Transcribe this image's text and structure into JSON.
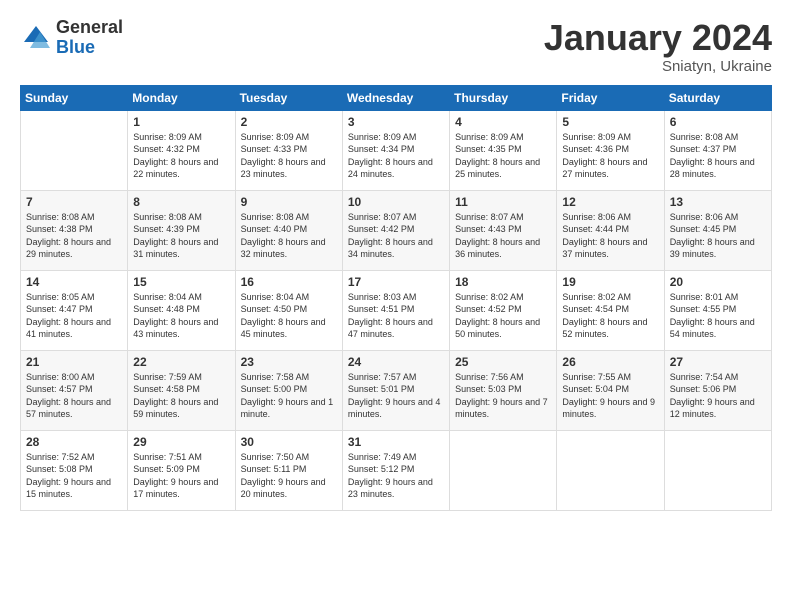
{
  "logo": {
    "general": "General",
    "blue": "Blue"
  },
  "header": {
    "month": "January 2024",
    "location": "Sniatyn, Ukraine"
  },
  "days_of_week": [
    "Sunday",
    "Monday",
    "Tuesday",
    "Wednesday",
    "Thursday",
    "Friday",
    "Saturday"
  ],
  "weeks": [
    [
      {
        "day": "",
        "sunrise": "",
        "sunset": "",
        "daylight": ""
      },
      {
        "day": "1",
        "sunrise": "Sunrise: 8:09 AM",
        "sunset": "Sunset: 4:32 PM",
        "daylight": "Daylight: 8 hours and 22 minutes."
      },
      {
        "day": "2",
        "sunrise": "Sunrise: 8:09 AM",
        "sunset": "Sunset: 4:33 PM",
        "daylight": "Daylight: 8 hours and 23 minutes."
      },
      {
        "day": "3",
        "sunrise": "Sunrise: 8:09 AM",
        "sunset": "Sunset: 4:34 PM",
        "daylight": "Daylight: 8 hours and 24 minutes."
      },
      {
        "day": "4",
        "sunrise": "Sunrise: 8:09 AM",
        "sunset": "Sunset: 4:35 PM",
        "daylight": "Daylight: 8 hours and 25 minutes."
      },
      {
        "day": "5",
        "sunrise": "Sunrise: 8:09 AM",
        "sunset": "Sunset: 4:36 PM",
        "daylight": "Daylight: 8 hours and 27 minutes."
      },
      {
        "day": "6",
        "sunrise": "Sunrise: 8:08 AM",
        "sunset": "Sunset: 4:37 PM",
        "daylight": "Daylight: 8 hours and 28 minutes."
      }
    ],
    [
      {
        "day": "7",
        "sunrise": "Sunrise: 8:08 AM",
        "sunset": "Sunset: 4:38 PM",
        "daylight": "Daylight: 8 hours and 29 minutes."
      },
      {
        "day": "8",
        "sunrise": "Sunrise: 8:08 AM",
        "sunset": "Sunset: 4:39 PM",
        "daylight": "Daylight: 8 hours and 31 minutes."
      },
      {
        "day": "9",
        "sunrise": "Sunrise: 8:08 AM",
        "sunset": "Sunset: 4:40 PM",
        "daylight": "Daylight: 8 hours and 32 minutes."
      },
      {
        "day": "10",
        "sunrise": "Sunrise: 8:07 AM",
        "sunset": "Sunset: 4:42 PM",
        "daylight": "Daylight: 8 hours and 34 minutes."
      },
      {
        "day": "11",
        "sunrise": "Sunrise: 8:07 AM",
        "sunset": "Sunset: 4:43 PM",
        "daylight": "Daylight: 8 hours and 36 minutes."
      },
      {
        "day": "12",
        "sunrise": "Sunrise: 8:06 AM",
        "sunset": "Sunset: 4:44 PM",
        "daylight": "Daylight: 8 hours and 37 minutes."
      },
      {
        "day": "13",
        "sunrise": "Sunrise: 8:06 AM",
        "sunset": "Sunset: 4:45 PM",
        "daylight": "Daylight: 8 hours and 39 minutes."
      }
    ],
    [
      {
        "day": "14",
        "sunrise": "Sunrise: 8:05 AM",
        "sunset": "Sunset: 4:47 PM",
        "daylight": "Daylight: 8 hours and 41 minutes."
      },
      {
        "day": "15",
        "sunrise": "Sunrise: 8:04 AM",
        "sunset": "Sunset: 4:48 PM",
        "daylight": "Daylight: 8 hours and 43 minutes."
      },
      {
        "day": "16",
        "sunrise": "Sunrise: 8:04 AM",
        "sunset": "Sunset: 4:50 PM",
        "daylight": "Daylight: 8 hours and 45 minutes."
      },
      {
        "day": "17",
        "sunrise": "Sunrise: 8:03 AM",
        "sunset": "Sunset: 4:51 PM",
        "daylight": "Daylight: 8 hours and 47 minutes."
      },
      {
        "day": "18",
        "sunrise": "Sunrise: 8:02 AM",
        "sunset": "Sunset: 4:52 PM",
        "daylight": "Daylight: 8 hours and 50 minutes."
      },
      {
        "day": "19",
        "sunrise": "Sunrise: 8:02 AM",
        "sunset": "Sunset: 4:54 PM",
        "daylight": "Daylight: 8 hours and 52 minutes."
      },
      {
        "day": "20",
        "sunrise": "Sunrise: 8:01 AM",
        "sunset": "Sunset: 4:55 PM",
        "daylight": "Daylight: 8 hours and 54 minutes."
      }
    ],
    [
      {
        "day": "21",
        "sunrise": "Sunrise: 8:00 AM",
        "sunset": "Sunset: 4:57 PM",
        "daylight": "Daylight: 8 hours and 57 minutes."
      },
      {
        "day": "22",
        "sunrise": "Sunrise: 7:59 AM",
        "sunset": "Sunset: 4:58 PM",
        "daylight": "Daylight: 8 hours and 59 minutes."
      },
      {
        "day": "23",
        "sunrise": "Sunrise: 7:58 AM",
        "sunset": "Sunset: 5:00 PM",
        "daylight": "Daylight: 9 hours and 1 minute."
      },
      {
        "day": "24",
        "sunrise": "Sunrise: 7:57 AM",
        "sunset": "Sunset: 5:01 PM",
        "daylight": "Daylight: 9 hours and 4 minutes."
      },
      {
        "day": "25",
        "sunrise": "Sunrise: 7:56 AM",
        "sunset": "Sunset: 5:03 PM",
        "daylight": "Daylight: 9 hours and 7 minutes."
      },
      {
        "day": "26",
        "sunrise": "Sunrise: 7:55 AM",
        "sunset": "Sunset: 5:04 PM",
        "daylight": "Daylight: 9 hours and 9 minutes."
      },
      {
        "day": "27",
        "sunrise": "Sunrise: 7:54 AM",
        "sunset": "Sunset: 5:06 PM",
        "daylight": "Daylight: 9 hours and 12 minutes."
      }
    ],
    [
      {
        "day": "28",
        "sunrise": "Sunrise: 7:52 AM",
        "sunset": "Sunset: 5:08 PM",
        "daylight": "Daylight: 9 hours and 15 minutes."
      },
      {
        "day": "29",
        "sunrise": "Sunrise: 7:51 AM",
        "sunset": "Sunset: 5:09 PM",
        "daylight": "Daylight: 9 hours and 17 minutes."
      },
      {
        "day": "30",
        "sunrise": "Sunrise: 7:50 AM",
        "sunset": "Sunset: 5:11 PM",
        "daylight": "Daylight: 9 hours and 20 minutes."
      },
      {
        "day": "31",
        "sunrise": "Sunrise: 7:49 AM",
        "sunset": "Sunset: 5:12 PM",
        "daylight": "Daylight: 9 hours and 23 minutes."
      },
      {
        "day": "",
        "sunrise": "",
        "sunset": "",
        "daylight": ""
      },
      {
        "day": "",
        "sunrise": "",
        "sunset": "",
        "daylight": ""
      },
      {
        "day": "",
        "sunrise": "",
        "sunset": "",
        "daylight": ""
      }
    ]
  ]
}
